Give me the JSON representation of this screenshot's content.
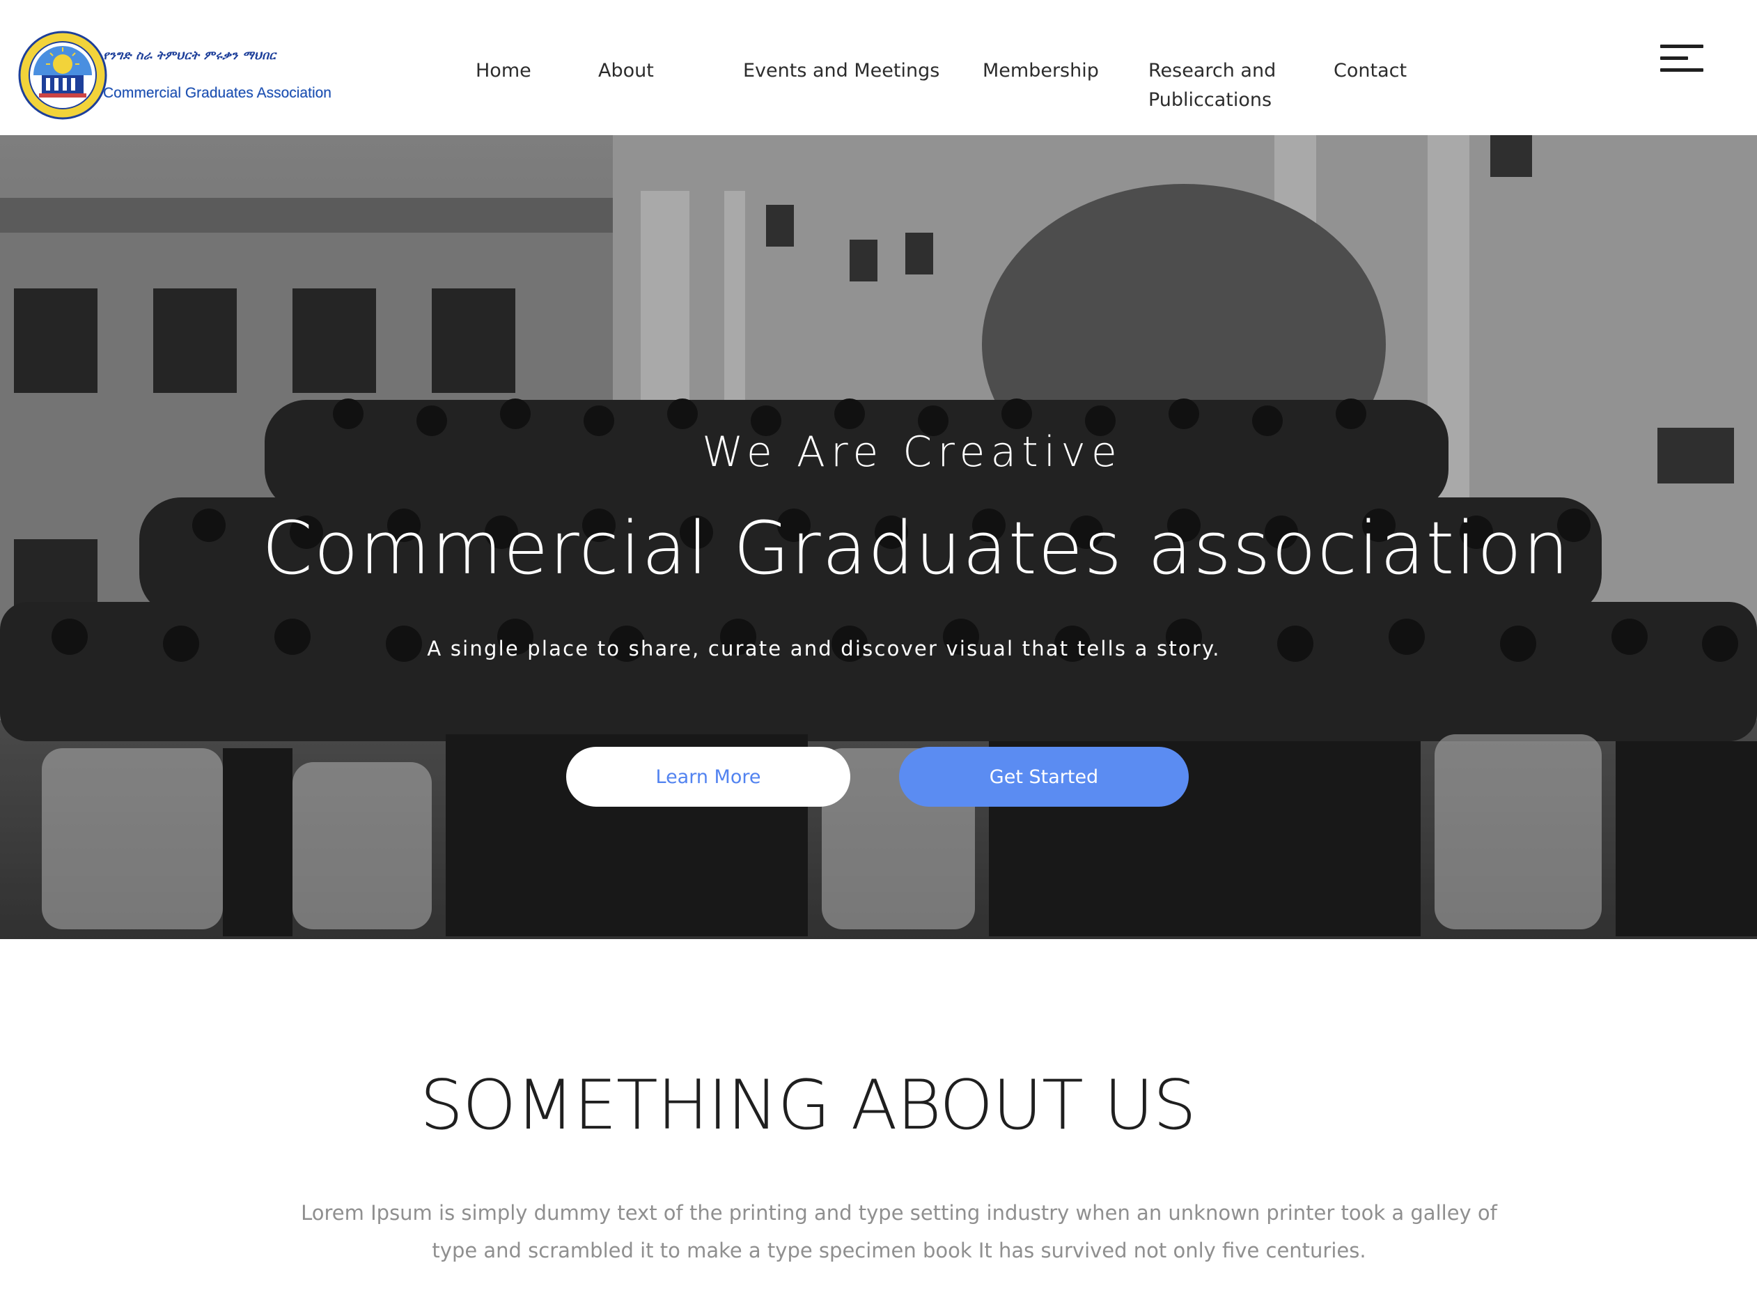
{
  "brand": {
    "amharic_name": "የንግድ ስራ ትምህርት ምሩቃን ማህበር",
    "english_name": "Commercial Graduates Association"
  },
  "nav": {
    "items": [
      {
        "label": "Home"
      },
      {
        "label": "About"
      },
      {
        "label": "Events and Meetings"
      },
      {
        "label": "Membership"
      },
      {
        "label": "Research and Publiccations"
      },
      {
        "label": "Contact"
      }
    ],
    "menu_icon": "hamburger-menu-icon"
  },
  "hero": {
    "kicker": "We Are Creative",
    "title": "Commercial Graduates association",
    "subtitle": "A single place to share, curate and discover visual that tells a story.",
    "learn_more_label": "Learn More",
    "get_started_label": "Get Started"
  },
  "about": {
    "title": "SOMETHING ABOUT US",
    "text": "Lorem Ipsum is simply dummy text of the printing and type setting industry when an unknown printer took a galley of type and scrambled it to make a type specimen book It has survived not only five centuries."
  },
  "colors": {
    "accent": "#5b8cf2",
    "nav_text": "#2c2c2c",
    "body_text": "#8f8f8f",
    "logo_blue": "#1d4fb0"
  }
}
